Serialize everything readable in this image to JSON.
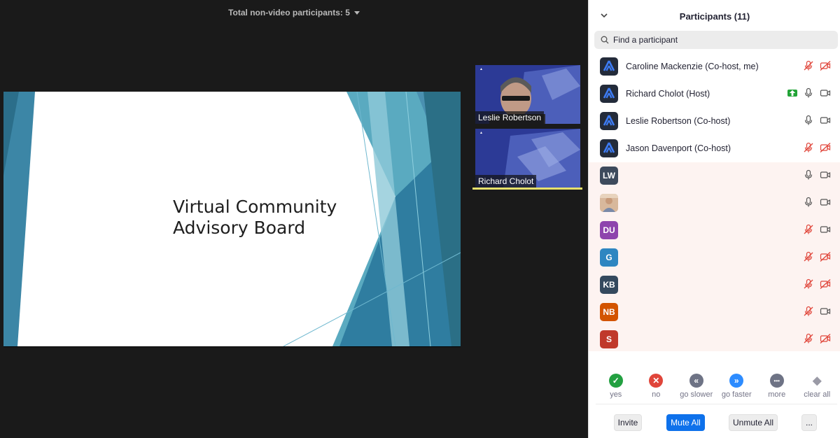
{
  "meeting": {
    "nonvideo_label": "Total non-video participants: 5",
    "slide_title": "Virtual Community\nAdvisory Board",
    "tiles": [
      {
        "name": "Leslie Robertson"
      },
      {
        "name": "Richard Cholot"
      }
    ]
  },
  "panel": {
    "title": "Participants (11)",
    "search_placeholder": "Find a participant",
    "participants": [
      {
        "name": "Caroline Mackenzie (Co-host, me)",
        "avatar": "logo",
        "mic": "muted",
        "video": "off"
      },
      {
        "name": "Richard Cholot (Host)",
        "avatar": "logo",
        "mic": "on",
        "video": "on",
        "sharing": true
      },
      {
        "name": "Leslie Robertson (Co-host)",
        "avatar": "logo",
        "mic": "on",
        "video": "on"
      },
      {
        "name": "Jason Davenport (Co-host)",
        "avatar": "logo",
        "mic": "muted",
        "video": "off"
      },
      {
        "name": "",
        "initials": "LW",
        "avatar_color": "#3d4a5c",
        "mic": "on",
        "video": "on"
      },
      {
        "name": "",
        "initials": "",
        "avatar": "photo",
        "mic": "on",
        "video": "on"
      },
      {
        "name": "",
        "initials": "DU",
        "avatar_color": "#8e44ad",
        "mic": "muted",
        "video": "on"
      },
      {
        "name": "",
        "initials": "G",
        "avatar_color": "#2e86c1",
        "mic": "muted",
        "video": "off"
      },
      {
        "name": "",
        "initials": "KB",
        "avatar_color": "#34495e",
        "mic": "muted",
        "video": "off"
      },
      {
        "name": "",
        "initials": "NB",
        "avatar_color": "#d35400",
        "mic": "muted",
        "video": "on"
      },
      {
        "name": "",
        "initials": "S",
        "avatar_color": "#c0392b",
        "mic": "muted",
        "video": "off"
      }
    ],
    "reactions": [
      {
        "label": "yes",
        "color": "#23a041",
        "glyph": "✓"
      },
      {
        "label": "no",
        "color": "#e0453a",
        "glyph": "✕"
      },
      {
        "label": "go slower",
        "color": "#6e7385",
        "glyph": "«"
      },
      {
        "label": "go faster",
        "color": "#2d8cff",
        "glyph": "»"
      },
      {
        "label": "more",
        "color": "#6e7385",
        "glyph": "•••"
      },
      {
        "label": "clear all",
        "color": "#9a9aa6",
        "glyph": "◆"
      }
    ],
    "footer": {
      "invite": "Invite",
      "mute_all": "Mute All",
      "unmute_all": "Unmute All",
      "more": "..."
    }
  },
  "colors": {
    "accent": "#0e71eb",
    "muted_red": "#e0453a",
    "active_speaker": "#e6e06c"
  }
}
